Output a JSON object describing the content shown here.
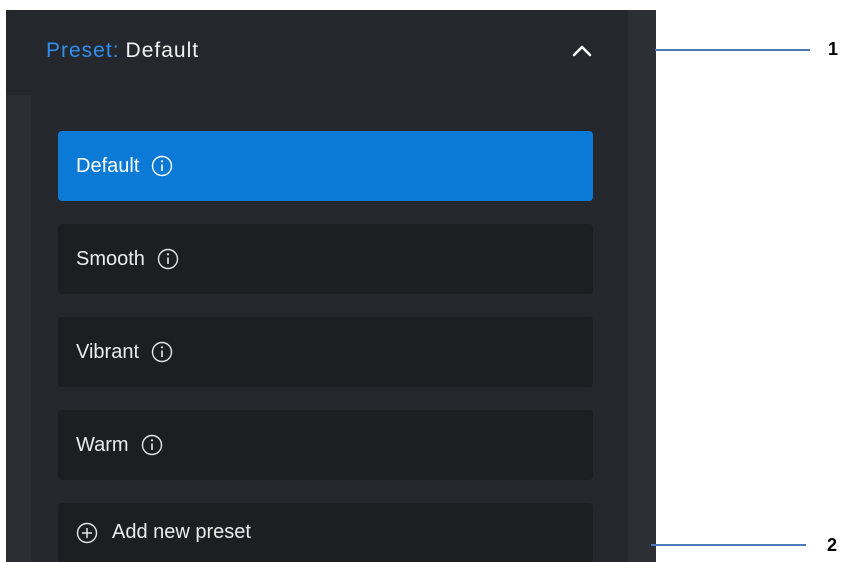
{
  "header": {
    "prefix": "Preset:",
    "value": "Default"
  },
  "presets": [
    {
      "label": "Default",
      "selected": true
    },
    {
      "label": "Smooth",
      "selected": false
    },
    {
      "label": "Vibrant",
      "selected": false
    },
    {
      "label": "Warm",
      "selected": false
    }
  ],
  "add_preset_label": "Add new preset",
  "callouts": [
    "1",
    "2"
  ],
  "colors": {
    "accent": "#0a7ad6",
    "prefix_blue": "#2f8ff0",
    "panel": "#24272c",
    "item": "#1c1e22",
    "callout_line": "#4a78b8"
  },
  "icons": {
    "collapse": "chevron-up-icon",
    "info": "info-icon",
    "add": "plus-circle-icon"
  }
}
